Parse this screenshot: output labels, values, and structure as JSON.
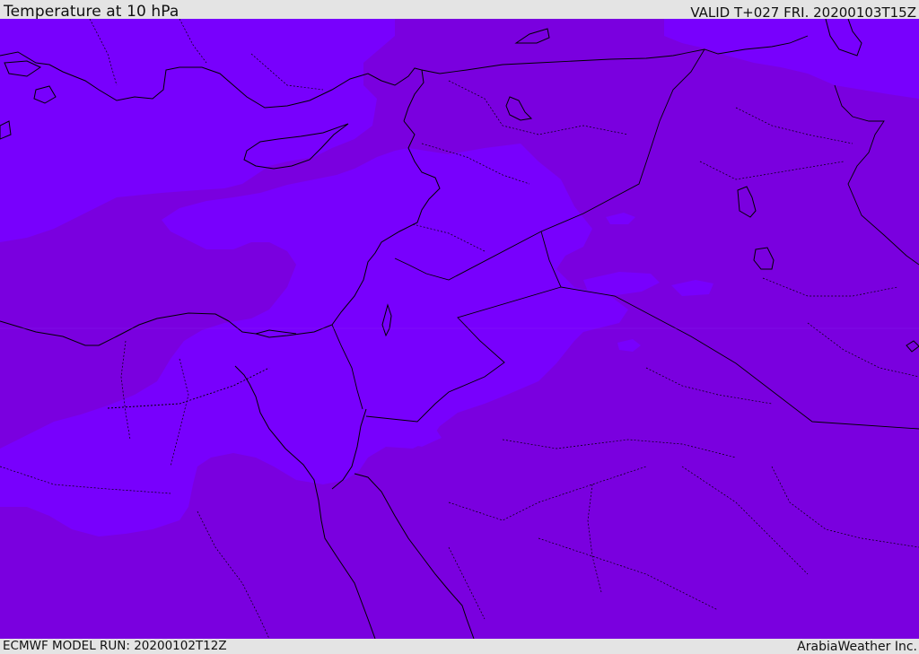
{
  "header": {
    "title": "Temperature at 10 hPa",
    "valid_time": "VALID T+027 FRI. 20200103T15Z"
  },
  "footer": {
    "model_run": "ECMWF MODEL RUN: 20200102T12Z",
    "credit": "ArabiaWeather Inc."
  },
  "colors": {
    "band_warm": "#7a00df",
    "band_cool": "#7800fd",
    "coastline": "#000000",
    "borders": "#000000",
    "bar_background": "#e4e4e4"
  }
}
